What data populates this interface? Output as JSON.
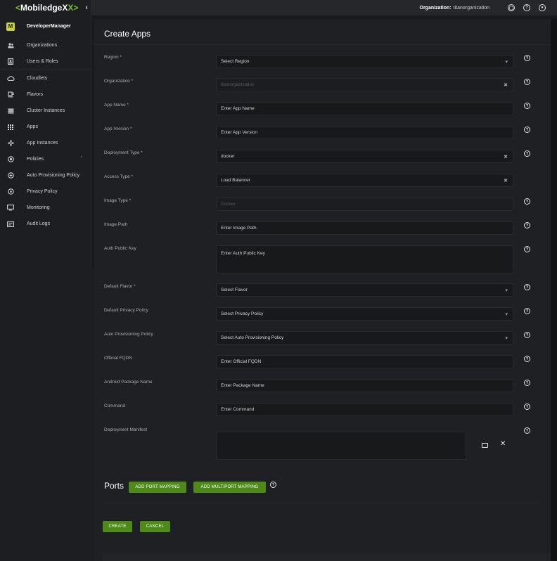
{
  "brand": {
    "logo_text": "MobiledgeX"
  },
  "sidebar": {
    "collapse_icon": "chevron-left-icon",
    "user": {
      "avatar_letter": "M",
      "name": "DeveloperManager"
    },
    "items": [
      {
        "label": "Organizations",
        "icon": "people-icon"
      },
      {
        "label": "Users & Roles",
        "icon": "id-badge-icon"
      },
      {
        "label": "Cloudlets",
        "icon": "cloud-icon"
      },
      {
        "label": "Flavors",
        "icon": "cup-icon"
      },
      {
        "label": "Cluster Instances",
        "icon": "storage-icon"
      },
      {
        "label": "Apps",
        "icon": "apps-grid-icon"
      },
      {
        "label": "App Instances",
        "icon": "gamepad-icon"
      },
      {
        "label": "Policies",
        "icon": "target-icon"
      },
      {
        "label": "Auto Provisioning Policy",
        "icon": "circle-plus-icon"
      },
      {
        "label": "Privacy Policy",
        "icon": "circle-dot-icon"
      },
      {
        "label": "Monitoring",
        "icon": "monitor-icon"
      },
      {
        "label": "Audit Logs",
        "icon": "log-icon"
      }
    ]
  },
  "topbar": {
    "org_label": "Organization:",
    "org_value": "titanorganization"
  },
  "form": {
    "title": "Create Apps",
    "fields": {
      "region": {
        "label": "Region *",
        "value": "Select Region"
      },
      "organization": {
        "label": "Organization *",
        "value": "titanorganization"
      },
      "app_name": {
        "label": "App Name *",
        "placeholder": "Enter App Name"
      },
      "app_version": {
        "label": "App Version *",
        "placeholder": "Enter App Version"
      },
      "deployment_type": {
        "label": "Deployment Type *",
        "value": "docker"
      },
      "access_type": {
        "label": "Access Type *",
        "value": "Load Balancer"
      },
      "image_type": {
        "label": "Image Type *",
        "value": "Docker"
      },
      "image_path": {
        "label": "Image Path",
        "placeholder": "Enter Image Path"
      },
      "auth_public_key": {
        "label": "Auth Public Key",
        "placeholder": "Enter Auth Public Key"
      },
      "default_flavor": {
        "label": "Default Flavor *",
        "value": "Select Flavor"
      },
      "default_privacy_policy": {
        "label": "Default Privacy Policy",
        "value": "Select Privacy Policy"
      },
      "auto_provisioning_policy": {
        "label": "Auto Provisioning Policy",
        "value": "Select Auto Provisioning Policy"
      },
      "official_fqdn": {
        "label": "Official FQDN",
        "placeholder": "Enter Official FQDN"
      },
      "android_package_name": {
        "label": "Android Package Name",
        "placeholder": "Enter Package Name"
      },
      "command": {
        "label": "Command",
        "placeholder": "Enter Command"
      },
      "deployment_manifest": {
        "label": "Deployment Manifest"
      }
    },
    "ports": {
      "title": "Ports",
      "add_port_mapping": "ADD PORT MAPPING",
      "add_multiport_mapping": "ADD MULTIPORT MAPPING"
    },
    "actions": {
      "create": "CREATE",
      "cancel": "CANCEL"
    }
  },
  "colors": {
    "accent_green": "#4e8a17",
    "logo_green": "#7bc32a",
    "avatar_yellow": "#c7d23a"
  }
}
